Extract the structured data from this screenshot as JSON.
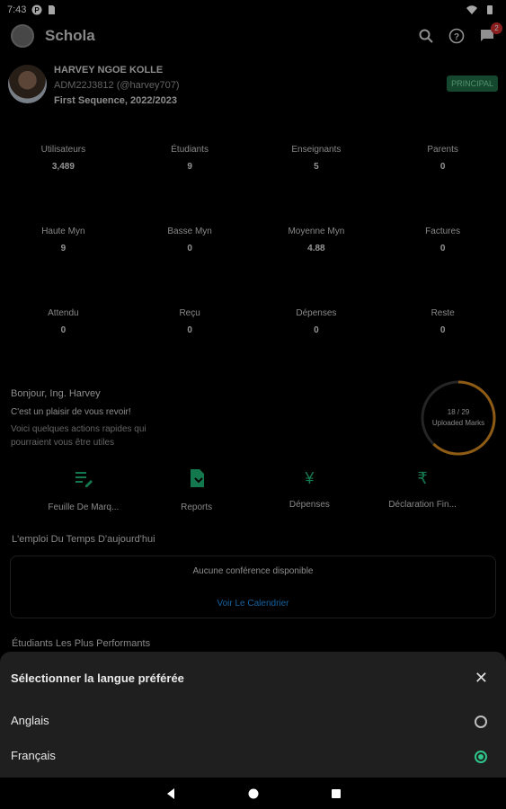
{
  "status": {
    "time": "7:43"
  },
  "app": {
    "title": "Schola",
    "notification_count": "2"
  },
  "profile": {
    "name": "HARVEY NGOE KOLLE",
    "id": "ADM22J3812 (@harvey707)",
    "sequence": "First Sequence, 2022/2023",
    "role": "PRINCIPAL"
  },
  "stats": [
    [
      {
        "label": "Utilisateurs",
        "value": "3,489"
      },
      {
        "label": "Étudiants",
        "value": "9"
      },
      {
        "label": "Enseignants",
        "value": "5"
      },
      {
        "label": "Parents",
        "value": "0"
      }
    ],
    [
      {
        "label": "Haute Myn",
        "value": "9"
      },
      {
        "label": "Basse Myn",
        "value": "0"
      },
      {
        "label": "Moyenne Myn",
        "value": "4.88"
      },
      {
        "label": "Factures",
        "value": "0"
      }
    ],
    [
      {
        "label": "Attendu",
        "value": "0"
      },
      {
        "label": "Reçu",
        "value": "0"
      },
      {
        "label": "Dépenses",
        "value": "0"
      },
      {
        "label": "Reste",
        "value": "0"
      }
    ]
  ],
  "greeting": {
    "hello": "Bonjour, Ing. Harvey",
    "message": "C'est un plaisir de vous revoir!",
    "sub": "Voici quelques actions rapides qui pourraient vous être utiles"
  },
  "progress": {
    "text": "18 / 29",
    "label": "Uploaded Marks",
    "fraction": 0.62
  },
  "quick_actions": [
    {
      "label": "Feuille De Marq...",
      "icon": "marksheet-icon"
    },
    {
      "label": "Reports",
      "icon": "report-icon"
    },
    {
      "label": "Dépenses",
      "icon": "yen-icon"
    },
    {
      "label": "Déclaration Fin...",
      "icon": "rupee-icon"
    }
  ],
  "timetable": {
    "title": "L'emploi Du Temps D'aujourd'hui",
    "empty": "Aucune conférence disponible",
    "link": "Voir Le Calendrier"
  },
  "top_students": {
    "title": "Étudiants Les Plus Performants"
  },
  "language_sheet": {
    "title": "Sélectionner la langue préférée",
    "options": [
      {
        "label": "Anglais",
        "selected": false
      },
      {
        "label": "Français",
        "selected": true
      }
    ]
  },
  "colors": {
    "accent": "#2ec68a",
    "ring": "#d98c1f",
    "link": "#2196f3"
  }
}
